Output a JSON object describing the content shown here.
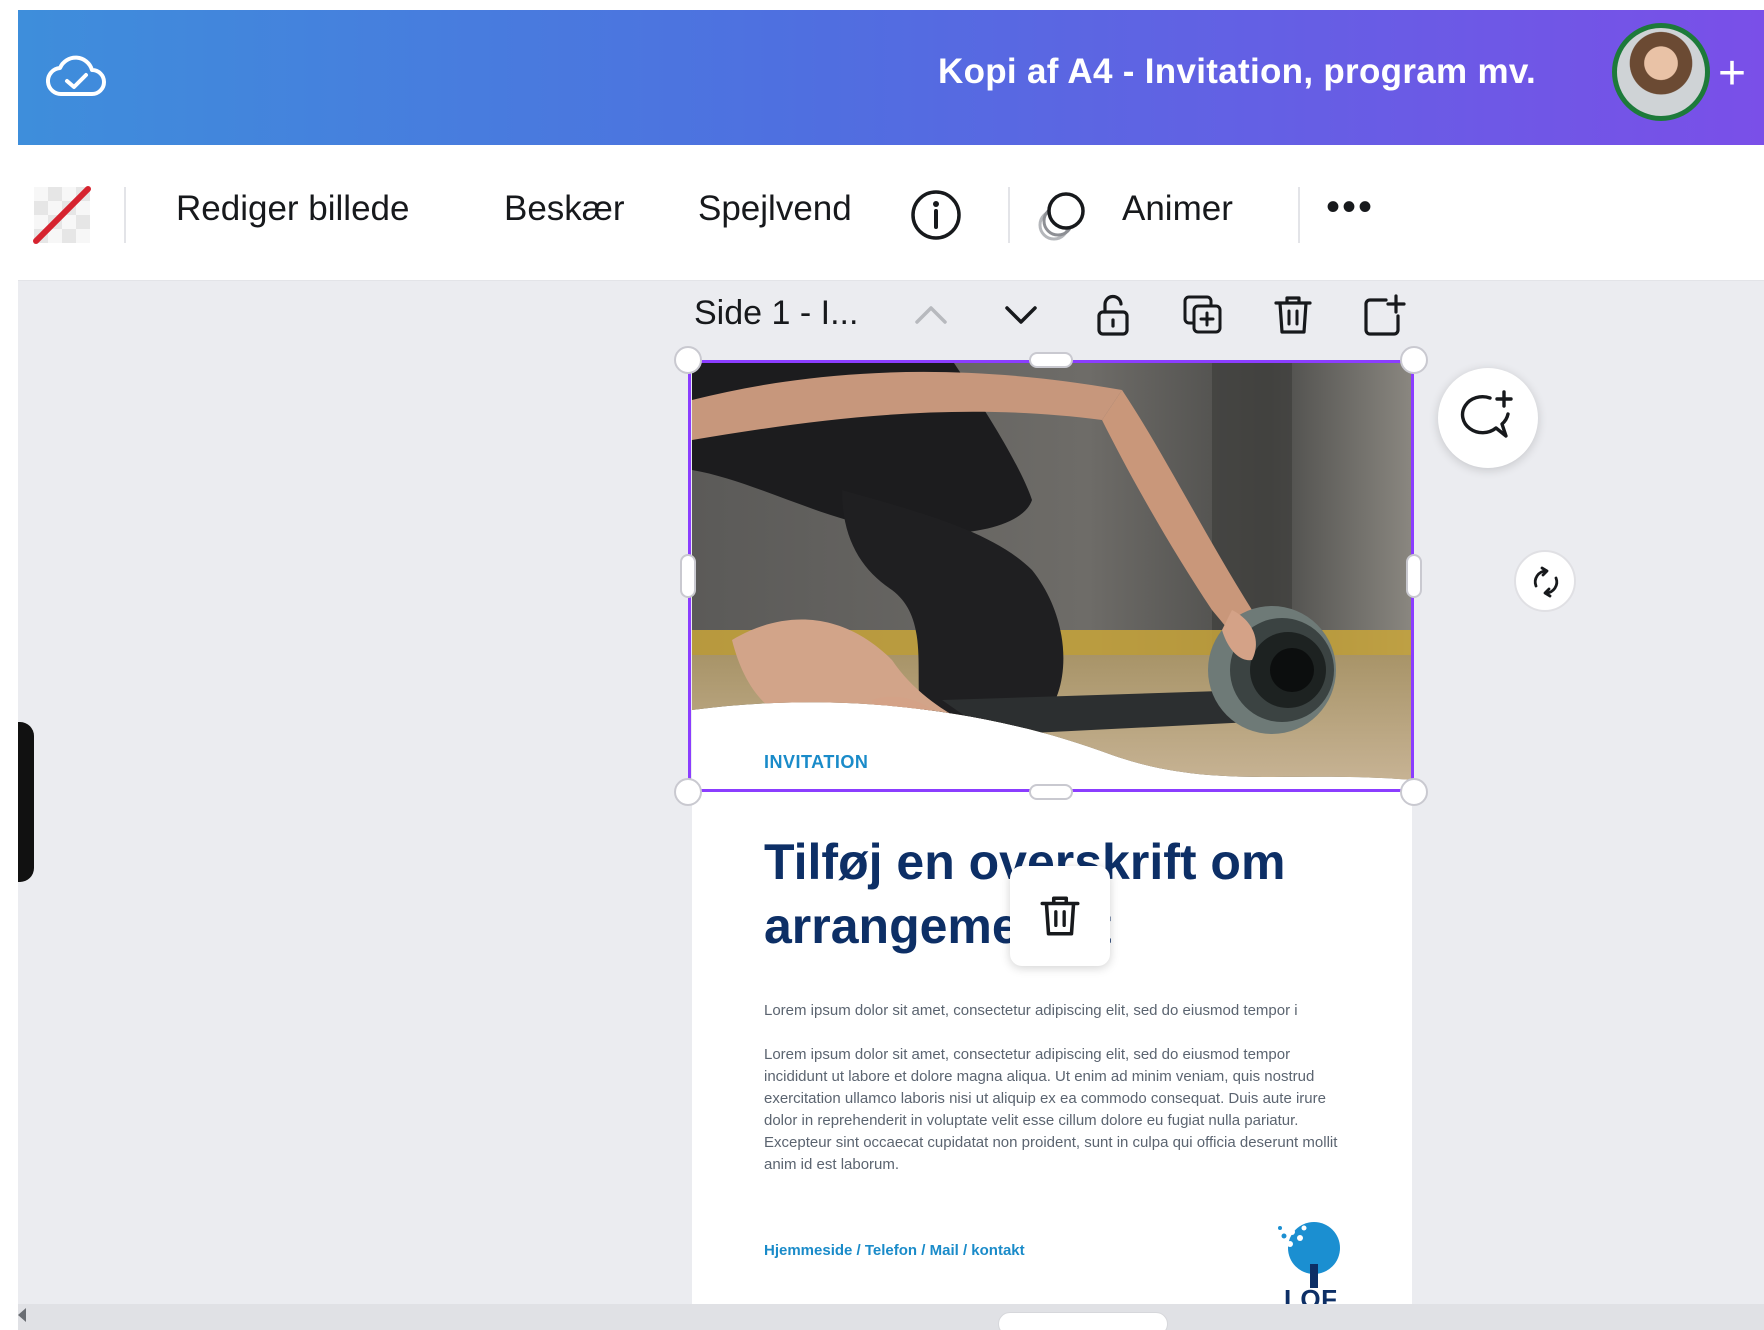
{
  "header": {
    "doc_title": "Kopi af A4 - Invitation, program mv.",
    "share_symbol": "+"
  },
  "toolbar": {
    "edit_image": "Rediger billede",
    "crop": "Beskær",
    "flip": "Spejlvend",
    "animate": "Animer",
    "more": "•••"
  },
  "page_bar": {
    "label": "Side 1 - I..."
  },
  "design": {
    "invitation": "INVITATION",
    "headline": "Tilføj en overskrift om arrangementet",
    "paragraph1": "Lorem ipsum dolor sit amet, consectetur adipiscing elit, sed do eiusmod tempor i",
    "paragraph2": "Lorem ipsum dolor sit amet, consectetur adipiscing elit, sed do eiusmod tempor incididunt ut labore et dolore magna aliqua. Ut enim ad minim veniam, quis nostrud exercitation ullamco laboris nisi ut aliquip ex ea commodo consequat. Duis aute irure dolor in reprehenderit in voluptate velit esse cillum dolore eu fugiat nulla pariatur. Excepteur sint occaecat cupidatat non proident, sunt in culpa qui officia deserunt mollit anim id est laborum.",
    "contact": "Hjemmeside / Telefon / Mail / kontakt",
    "logo_text": "LOF"
  },
  "colors": {
    "selection": "#8b3dff",
    "headline": "#0d2f66",
    "accent": "#1a8bc9"
  },
  "icons": [
    "cloud-check-icon",
    "transparency-icon",
    "info-icon",
    "animate-icon",
    "more-icon",
    "chevron-up-icon",
    "chevron-down-icon",
    "lock-icon",
    "duplicate-page-icon",
    "trash-icon",
    "add-page-icon",
    "add-comment-icon",
    "rotate-icon"
  ]
}
